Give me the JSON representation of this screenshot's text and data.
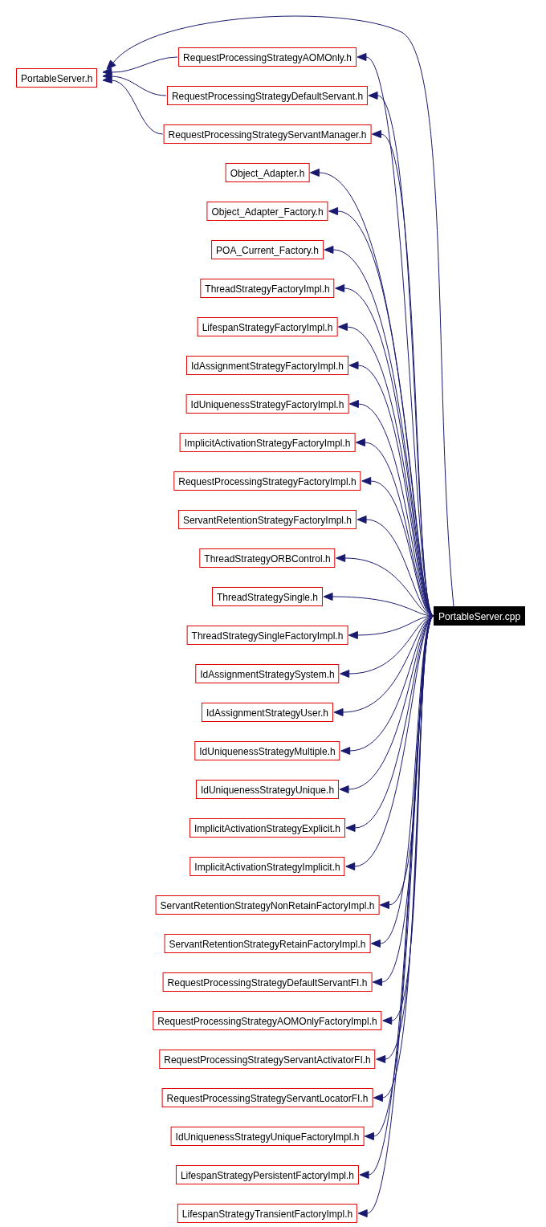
{
  "graph": {
    "source": {
      "label": "PortableServer.cpp"
    },
    "top": {
      "label": "PortableServer.h",
      "truncated": true
    },
    "headers": [
      {
        "label": "RequestProcessingStrategyAOMOnly.h",
        "truncated": true,
        "includes_top": true
      },
      {
        "label": "RequestProcessingStrategyDefaultServant.h",
        "truncated": true,
        "includes_top": true
      },
      {
        "label": "RequestProcessingStrategyServantManager.h",
        "truncated": true,
        "includes_top": true
      },
      {
        "label": "Object_Adapter.h",
        "truncated": true,
        "includes_top": false
      },
      {
        "label": "Object_Adapter_Factory.h",
        "truncated": true,
        "includes_top": false
      },
      {
        "label": "POA_Current_Factory.h",
        "truncated": true,
        "includes_top": false
      },
      {
        "label": "ThreadStrategyFactoryImpl.h",
        "truncated": true,
        "includes_top": false
      },
      {
        "label": "LifespanStrategyFactoryImpl.h",
        "truncated": true,
        "includes_top": false
      },
      {
        "label": "IdAssignmentStrategyFactoryImpl.h",
        "truncated": true,
        "includes_top": false
      },
      {
        "label": "IdUniquenessStrategyFactoryImpl.h",
        "truncated": true,
        "includes_top": false
      },
      {
        "label": "ImplicitActivationStrategyFactoryImpl.h",
        "truncated": true,
        "includes_top": false
      },
      {
        "label": "RequestProcessingStrategyFactoryImpl.h",
        "truncated": true,
        "includes_top": false
      },
      {
        "label": "ServantRetentionStrategyFactoryImpl.h",
        "truncated": true,
        "includes_top": false
      },
      {
        "label": "ThreadStrategyORBControl.h",
        "truncated": true,
        "includes_top": false
      },
      {
        "label": "ThreadStrategySingle.h",
        "truncated": true,
        "includes_top": false
      },
      {
        "label": "ThreadStrategySingleFactoryImpl.h",
        "truncated": true,
        "includes_top": false
      },
      {
        "label": "IdAssignmentStrategySystem.h",
        "truncated": true,
        "includes_top": false
      },
      {
        "label": "IdAssignmentStrategyUser.h",
        "truncated": true,
        "includes_top": false
      },
      {
        "label": "IdUniquenessStrategyMultiple.h",
        "truncated": true,
        "includes_top": false
      },
      {
        "label": "IdUniquenessStrategyUnique.h",
        "truncated": true,
        "includes_top": false
      },
      {
        "label": "ImplicitActivationStrategyExplicit.h",
        "truncated": true,
        "includes_top": false
      },
      {
        "label": "ImplicitActivationStrategyImplicit.h",
        "truncated": true,
        "includes_top": false
      },
      {
        "label": "ServantRetentionStrategyNonRetainFactoryImpl.h",
        "truncated": true,
        "includes_top": false
      },
      {
        "label": "ServantRetentionStrategyRetainFactoryImpl.h",
        "truncated": true,
        "includes_top": false
      },
      {
        "label": "RequestProcessingStrategyDefaultServantFI.h",
        "truncated": true,
        "includes_top": false
      },
      {
        "label": "RequestProcessingStrategyAOMOnlyFactoryImpl.h",
        "truncated": true,
        "includes_top": false
      },
      {
        "label": "RequestProcessingStrategyServantActivatorFI.h",
        "truncated": true,
        "includes_top": false
      },
      {
        "label": "RequestProcessingStrategyServantLocatorFI.h",
        "truncated": true,
        "includes_top": false
      },
      {
        "label": "IdUniquenessStrategyUniqueFactoryImpl.h",
        "truncated": true,
        "includes_top": false
      },
      {
        "label": "LifespanStrategyPersistentFactoryImpl.h",
        "truncated": true,
        "includes_top": false
      },
      {
        "label": "LifespanStrategyTransientFactoryImpl.h",
        "truncated": true,
        "includes_top": false
      }
    ]
  }
}
